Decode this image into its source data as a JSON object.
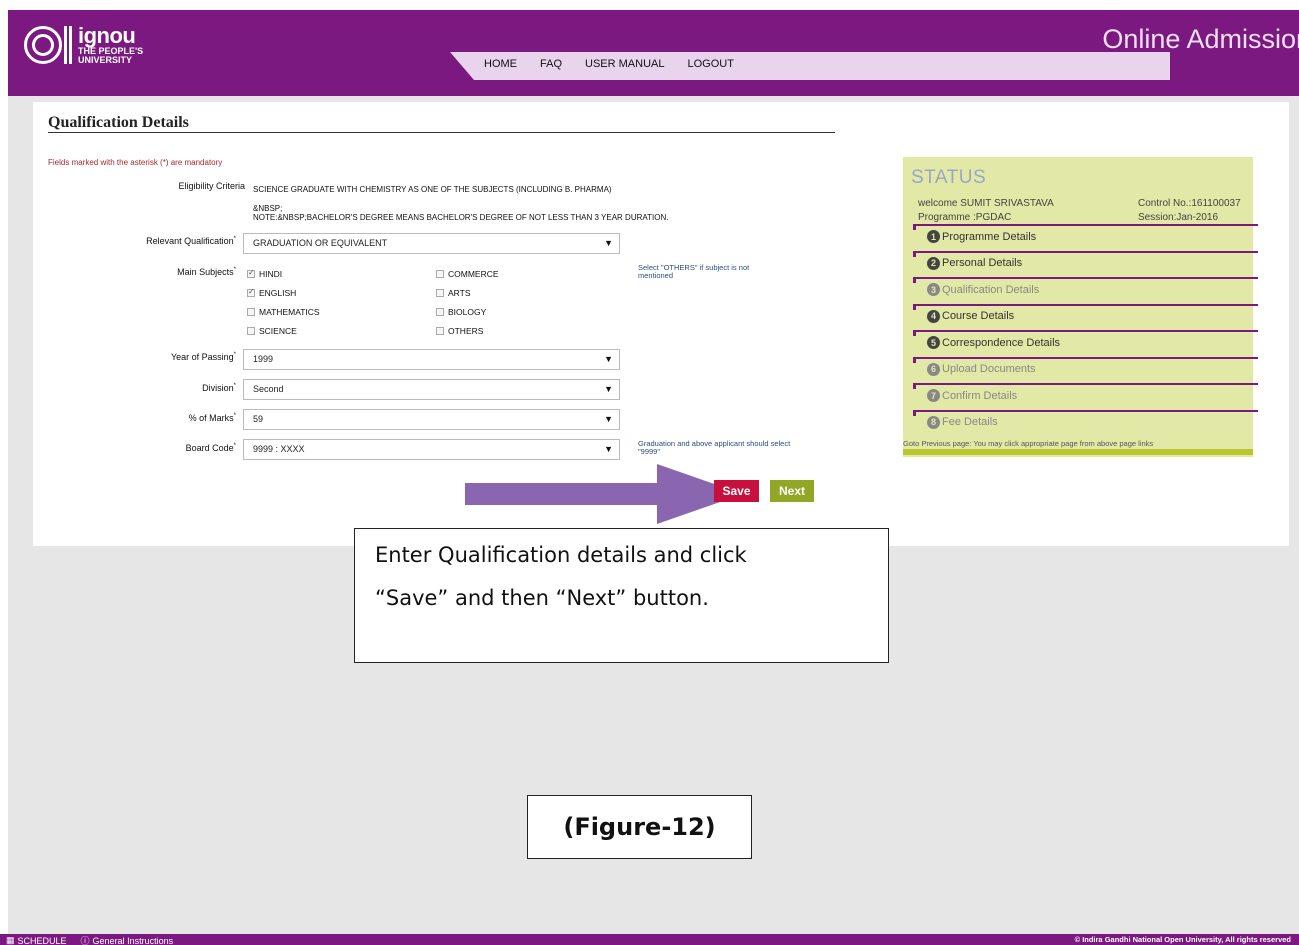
{
  "header": {
    "logo_name": "ignou",
    "logo_sub1": "THE PEOPLE'S",
    "logo_sub2": "UNIVERSITY",
    "title": "Online Admission",
    "nav": [
      "HOME",
      "FAQ",
      "USER MANUAL",
      "LOGOUT"
    ]
  },
  "form": {
    "title": "Qualification Details",
    "mandatory_note": "Fields marked with the asterisk (*) are mandatory",
    "eligibility_label": "Eligibility Criteria",
    "eligibility_text": "SCIENCE GRADUATE WITH CHEMISTRY AS ONE OF THE SUBJECTS (INCLUDING B. PHARMA)",
    "eligibility_nbsp": "&NBSP;",
    "eligibility_note": "NOTE:&NBSP;BACHELOR'S DEGREE MEANS BACHELOR'S DEGREE OF NOT LESS THAN 3 YEAR DURATION.",
    "relevant_label": "Relevant Qualification",
    "relevant_value": "GRADUATION OR EQUIVALENT",
    "subjects_label": "Main Subjects",
    "subjects": [
      {
        "label": "HINDI",
        "checked": true
      },
      {
        "label": "COMMERCE",
        "checked": false
      },
      {
        "label": "ENGLISH",
        "checked": true
      },
      {
        "label": "ARTS",
        "checked": false
      },
      {
        "label": "MATHEMATICS",
        "checked": false
      },
      {
        "label": "BIOLOGY",
        "checked": false
      },
      {
        "label": "SCIENCE",
        "checked": false
      },
      {
        "label": "OTHERS",
        "checked": false
      }
    ],
    "subjects_hint": "Select \"OTHERS\" if subject is not mentioned",
    "year_label": "Year of Passing",
    "year_value": "1999",
    "division_label": "Division",
    "division_value": "Second",
    "marks_label": "% of Marks",
    "marks_value": "59",
    "board_label": "Board Code",
    "board_value": "9999 : XXXX",
    "board_hint": "Graduation and above applicant should select \"9999\"",
    "asterisk": "*",
    "save_label": "Save",
    "next_label": "Next"
  },
  "status": {
    "title": "STATUS",
    "welcome": "welcome SUMIT SRIVASTAVA",
    "programme": "Programme :PGDAC",
    "control": "Control No.:161100037",
    "session": "Session:Jan-2016",
    "steps": [
      {
        "num": "1",
        "label": "Programme Details",
        "state": "done"
      },
      {
        "num": "2",
        "label": "Personal Details",
        "state": "done"
      },
      {
        "num": "3",
        "label": "Qualification Details",
        "state": "pending"
      },
      {
        "num": "4",
        "label": "Course Details",
        "state": "done"
      },
      {
        "num": "5",
        "label": "Correspondence Details",
        "state": "done"
      },
      {
        "num": "6",
        "label": "Upload Documents",
        "state": "pending"
      },
      {
        "num": "7",
        "label": "Confirm Details",
        "state": "pending"
      },
      {
        "num": "8",
        "label": "Fee Details",
        "state": "pending"
      }
    ],
    "note": "Goto Previous page: You may click appropriate page from above page links"
  },
  "callout": {
    "line1": "Enter Qualification details and click",
    "line2": "“Save” and then “Next” button."
  },
  "figure_label": "(Figure-12)",
  "footer": {
    "schedule": "SCHEDULE",
    "instructions": "General Instructions",
    "copyright": "© Indira Gandhi National Open University, All rights reserved"
  },
  "colors": {
    "brand_purple": "#7b1981",
    "status_bg": "#e2e9a6",
    "save_red": "#c8103e",
    "next_green": "#93a726",
    "arrow_purple": "#8a66b0"
  }
}
